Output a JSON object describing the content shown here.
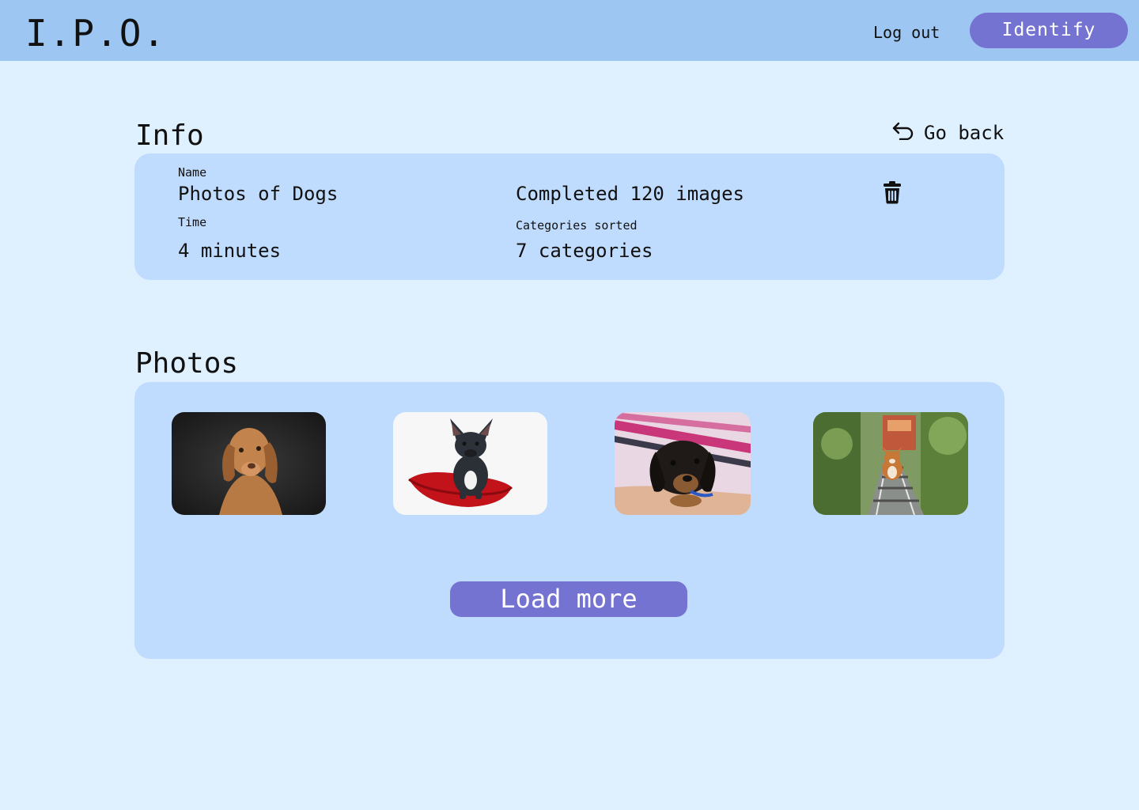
{
  "header": {
    "logo": "I.P.O.",
    "logout_label": "Log out",
    "identify_label": "Identify"
  },
  "info": {
    "title": "Info",
    "go_back_label": "Go back",
    "name_label": "Name",
    "name_value": "Photos of Dogs",
    "completed_value": "Completed 120 images",
    "time_label": "Time",
    "time_value": "4 minutes",
    "categories_label": "Categories sorted",
    "categories_value": "7 categories",
    "delete_icon": "trash-icon"
  },
  "photos": {
    "title": "Photos",
    "load_more_label": "Load more",
    "items": [
      {
        "subject": "brown dog on dark background"
      },
      {
        "subject": "french bulldog on red cushion"
      },
      {
        "subject": "dachshund puppy"
      },
      {
        "subject": "corgi on railway tracks"
      }
    ]
  },
  "colors": {
    "background": "#dff0ff",
    "topbar": "#9dc7f2",
    "panel": "#bfdbfd",
    "accent": "#7473d1"
  }
}
